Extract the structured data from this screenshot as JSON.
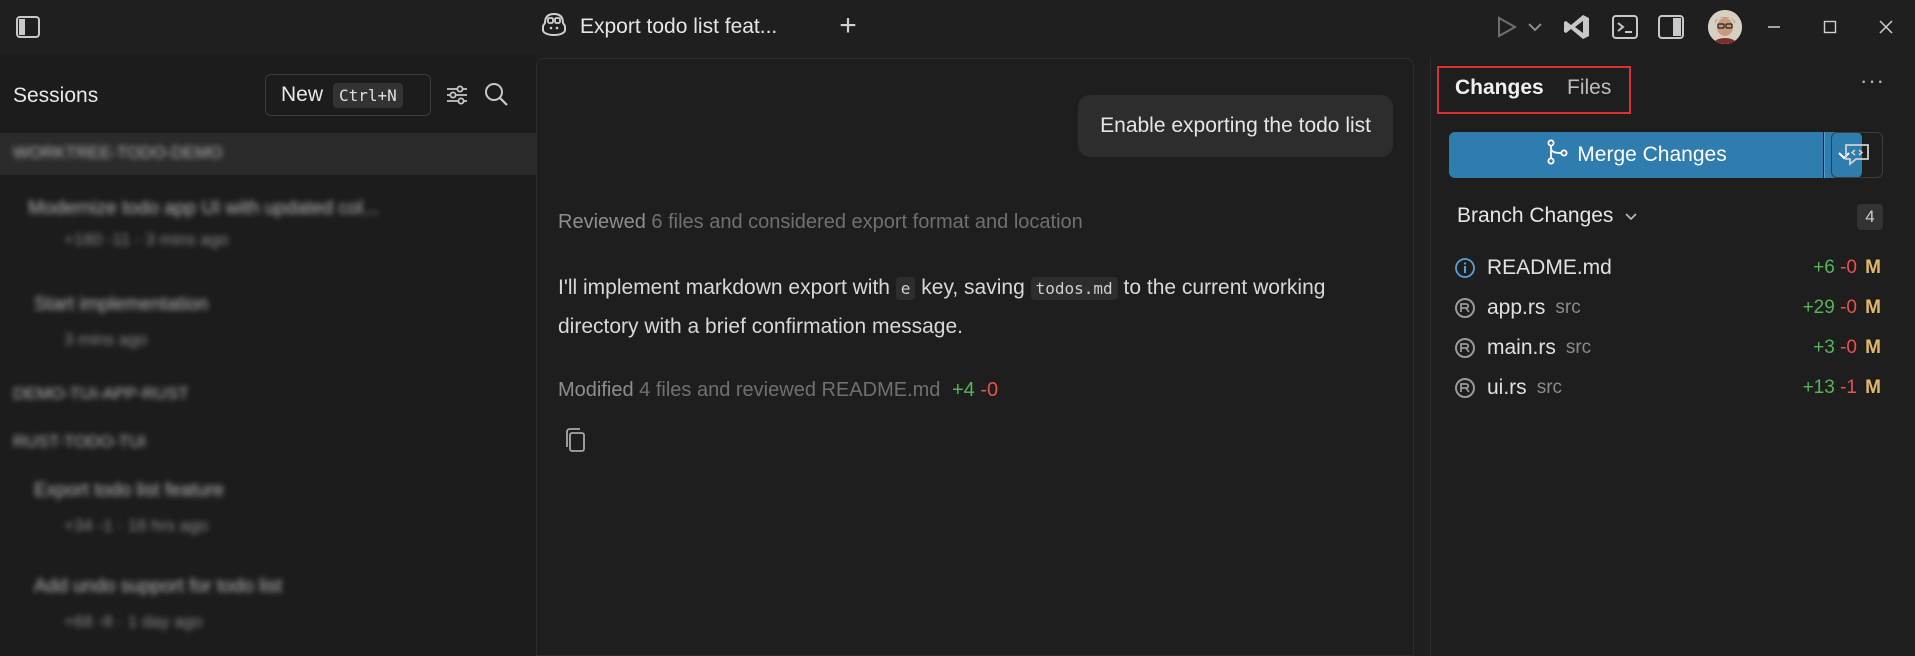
{
  "title_bar": {
    "tab_title": "Export todo list feat...",
    "new_tab_symbol": "+"
  },
  "sidebar": {
    "title": "Sessions",
    "new_label": "New",
    "new_shortcut": "Ctrl+N",
    "items": [
      {
        "type": "group",
        "text": "WORKTREE-TODO-DEMO"
      },
      {
        "type": "session",
        "text": "Modernize todo app UI with updated col...",
        "meta": "+180 -11 · 3 mins ago"
      },
      {
        "type": "session",
        "text": "Start implementation",
        "meta": "3 mins ago"
      },
      {
        "type": "group",
        "text": "DEMO-TUI-APP-RUST"
      },
      {
        "type": "group",
        "text": "RUST-TODO-TUI"
      },
      {
        "type": "session",
        "text": "Export todo list feature",
        "meta": "+34 -1 · 16 hrs ago"
      },
      {
        "type": "session",
        "text": "Add undo support for todo list",
        "meta": "+68 -8 · 1 day ago"
      }
    ]
  },
  "chat": {
    "user_message": "Enable exporting the todo list",
    "reviewed": {
      "verb": "Reviewed",
      "detail": "6 files and considered export format and location"
    },
    "answer": {
      "p1": "I'll implement markdown export with ",
      "code1": "e",
      "p2": " key, saving ",
      "code2": "todos.md",
      "p3": " to the current working directory with a brief confirmation message."
    },
    "modified": {
      "verb": "Modified",
      "detail": "4 files and reviewed README.md",
      "added": "+4",
      "removed": "-0"
    }
  },
  "right_panel": {
    "tabs": [
      {
        "label": "Changes",
        "active": true
      },
      {
        "label": "Files",
        "active": false
      }
    ],
    "merge_label": "Merge Changes",
    "branch_changes_label": "Branch Changes",
    "branch_changes_count": "4",
    "files": [
      {
        "name": "README.md",
        "dir": "",
        "added": "+6",
        "removed": "-0",
        "status": "M",
        "icon": "info-icon"
      },
      {
        "name": "app.rs",
        "dir": "src",
        "added": "+29",
        "removed": "-0",
        "status": "M",
        "icon": "rust-icon"
      },
      {
        "name": "main.rs",
        "dir": "src",
        "added": "+3",
        "removed": "-0",
        "status": "M",
        "icon": "rust-icon"
      },
      {
        "name": "ui.rs",
        "dir": "src",
        "added": "+13",
        "removed": "-1",
        "status": "M",
        "icon": "rust-icon"
      }
    ]
  },
  "colors": {
    "accent": "#2f7cae",
    "added": "#57b35b",
    "removed": "#e5534b",
    "modified": "#e2b86b",
    "highlight_box": "#d93030"
  }
}
